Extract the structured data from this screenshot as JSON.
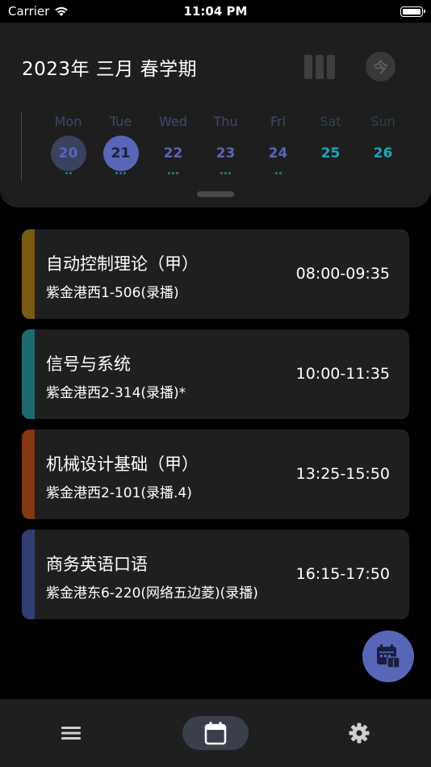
{
  "status_bar": {
    "carrier": "Carrier",
    "time": "11:04 PM"
  },
  "header": {
    "term_title": "2023年 三月 春学期",
    "today_button_label": "今",
    "days": [
      {
        "name": "Mon",
        "date": "20",
        "dots": 2,
        "name_color": "#3b4a6b",
        "num_color": "#5866b8",
        "circle": "#3a4260"
      },
      {
        "name": "Tue",
        "date": "21",
        "dots": 3,
        "name_color": "#3b4a6b",
        "num_color": "#1b1f3c",
        "circle": "#5866b8"
      },
      {
        "name": "Wed",
        "date": "22",
        "dots": 3,
        "name_color": "#3b4a6b",
        "num_color": "#5866b8",
        "circle": ""
      },
      {
        "name": "Thu",
        "date": "23",
        "dots": 3,
        "name_color": "#3b4a6b",
        "num_color": "#5866b8",
        "circle": ""
      },
      {
        "name": "Fri",
        "date": "24",
        "dots": 2,
        "name_color": "#3b4a6b",
        "num_color": "#5866b8",
        "circle": ""
      },
      {
        "name": "Sat",
        "date": "25",
        "dots": 0,
        "name_color": "#24474f",
        "num_color": "#1aa7b8",
        "circle": ""
      },
      {
        "name": "Sun",
        "date": "26",
        "dots": 0,
        "name_color": "#24474f",
        "num_color": "#1aa7b8",
        "circle": ""
      }
    ]
  },
  "courses": [
    {
      "name": "自动控制理论（甲）",
      "room": "紫金港西1-506(录播)",
      "time": "08:00-09:35",
      "color": "#7a5a12"
    },
    {
      "name": "信号与系统",
      "room": "紫金港西2-314(录播)*",
      "time": "10:00-11:35",
      "color": "#1f6a6e"
    },
    {
      "name": "机械设计基础（甲）",
      "room": "紫金港西2-101(录播.4)",
      "time": "13:25-15:50",
      "color": "#83380f"
    },
    {
      "name": "商务英语口语",
      "room": "紫金港东6-220(网络五边菱)(录播)",
      "time": "16:15-17:50",
      "color": "#323f74"
    }
  ],
  "icons": {
    "wifi": "wifi-icon",
    "battery": "battery-icon",
    "fab": "calendar-book-icon",
    "nav_courses": "list-icon",
    "nav_schedule": "calendar-icon",
    "nav_settings": "gear-icon"
  },
  "colors": {
    "accent": "#5866b8",
    "card_bg": "#1f1f1f",
    "header_bg": "#1e1e1e"
  }
}
